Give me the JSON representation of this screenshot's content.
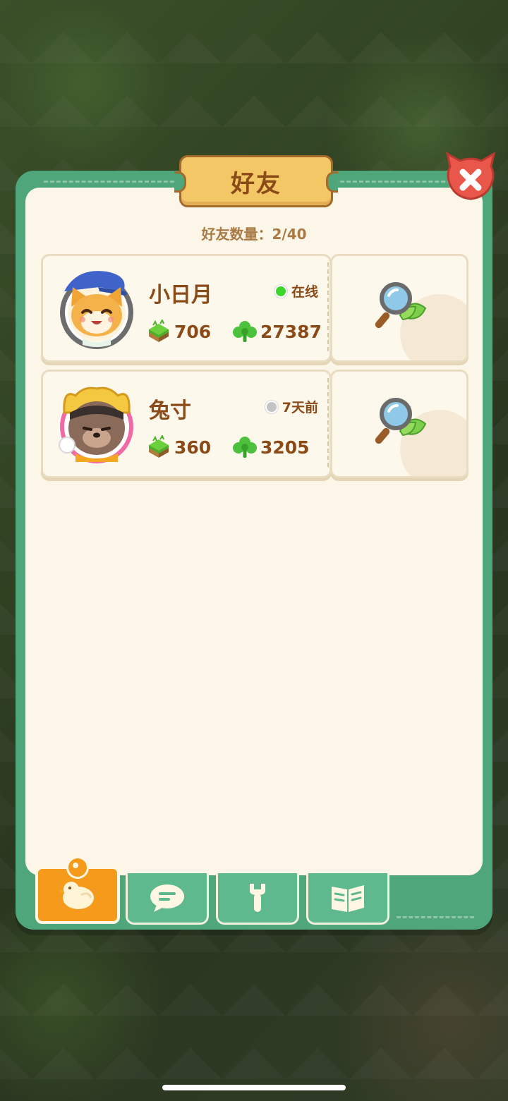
{
  "panel": {
    "title": "好友",
    "count_label": "好友数量：",
    "count_value": "2/40"
  },
  "friends": [
    {
      "name": "小日月",
      "status_text": "在线",
      "status_color": "#3fd62a",
      "land": "706",
      "clover": "27387",
      "avatar_icon": "cat-avatar-icon"
    },
    {
      "name": "兔寸",
      "status_text": "7天前",
      "status_color": "#c4c4c4",
      "land": "360",
      "clover": "3205",
      "avatar_icon": "bear-avatar-icon"
    }
  ],
  "tabs": [
    {
      "icon": "chick-icon",
      "active": true
    },
    {
      "icon": "chat-icon",
      "active": false
    },
    {
      "icon": "wrench-icon",
      "active": false
    },
    {
      "icon": "guide-book-icon",
      "active": false
    }
  ],
  "colors": {
    "panel_green": "#4fa67a",
    "title_gold": "#f4c766",
    "text_brown": "#8a4b19",
    "active_tab_orange": "#f59a1a"
  }
}
